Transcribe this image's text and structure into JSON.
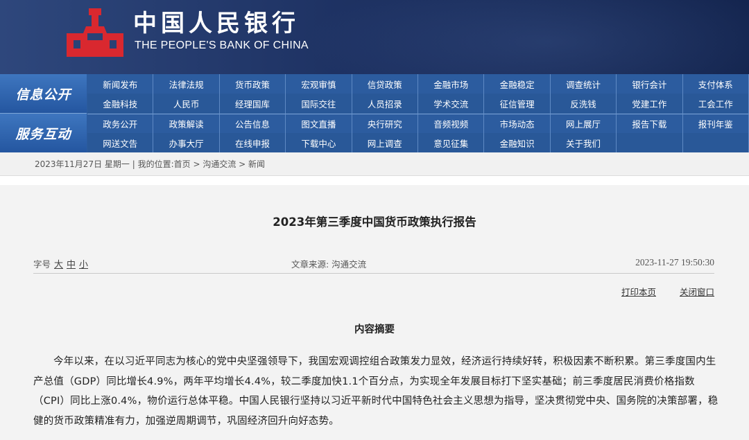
{
  "header": {
    "bank_name_cn": "中国人民银行",
    "bank_name_en": "THE PEOPLE'S BANK OF CHINA",
    "logo_icon": "pboc-logo-icon",
    "logo_color": "#d9282f"
  },
  "nav": {
    "side_labels": [
      "信息公开",
      "服务互动"
    ],
    "rows": [
      [
        "新闻发布",
        "法律法规",
        "货币政策",
        "宏观审慎",
        "信贷政策",
        "金融市场",
        "金融稳定",
        "调查统计",
        "银行会计",
        "支付体系"
      ],
      [
        "金融科技",
        "人民币",
        "经理国库",
        "国际交往",
        "人员招录",
        "学术交流",
        "征信管理",
        "反洗钱",
        "党建工作",
        "工会工作"
      ],
      [
        "政务公开",
        "政策解读",
        "公告信息",
        "图文直播",
        "央行研究",
        "音频视频",
        "市场动态",
        "网上展厅",
        "报告下载",
        "报刊年鉴"
      ],
      [
        "网送文告",
        "办事大厅",
        "在线申报",
        "下载中心",
        "网上调查",
        "意见征集",
        "金融知识",
        "关于我们"
      ]
    ]
  },
  "breadcrumb": {
    "date": "2023年11月27日 星期一",
    "sep": " | ",
    "prefix": "我的位置:",
    "home": "首页",
    "arrow1": " > ",
    "section": "沟通交流",
    "arrow2": " > ",
    "current": "新闻"
  },
  "article": {
    "title": "2023年第三季度中国货币政策执行报告",
    "font_size_label": "字号",
    "font_sizes": [
      "大",
      "中",
      "小"
    ],
    "source": "文章来源: 沟通交流",
    "datetime": "2023-11-27 19:50:30",
    "print_label": "打印本页",
    "close_label": "关闭窗口",
    "section_heading": "内容摘要",
    "paragraph": "今年以来，在以习近平同志为核心的党中央坚强领导下，我国宏观调控组合政策发力显效，经济运行持续好转，积极因素不断积累。第三季度国内生产总值（GDP）同比增长4.9%，两年平均增长4.4%，较二季度加快1.1个百分点，为实现全年发展目标打下坚实基础；前三季度居民消费价格指数（CPI）同比上涨0.4%，物价运行总体平稳。中国人民银行坚持以习近平新时代中国特色社会主义思想为指导，坚决贯彻党中央、国务院的决策部署，稳健的货币政策精准有力，加强逆周期调节，巩固经济回升向好态势。"
  }
}
